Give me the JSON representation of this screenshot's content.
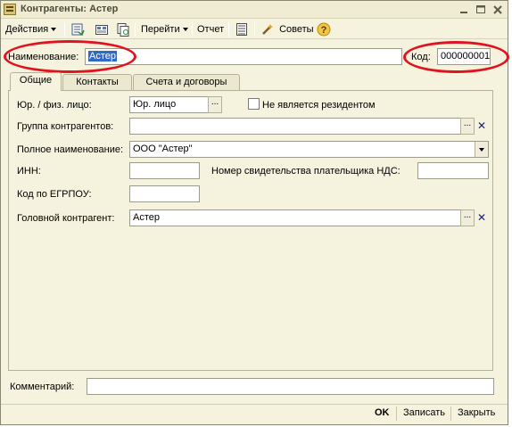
{
  "window": {
    "title": "Контрагенты: Астер"
  },
  "toolbar": {
    "actions_label": "Действия",
    "goto_label": "Перейти",
    "report_label": "Отчет",
    "tips_label": "Советы"
  },
  "header": {
    "name_label": "Наименование:",
    "name_value": "Астер",
    "code_label": "Код:",
    "code_value": "000000001"
  },
  "tabs": [
    {
      "label": "Общие",
      "active": true
    },
    {
      "label": "Контакты",
      "active": false
    },
    {
      "label": "Счета и договоры",
      "active": false
    }
  ],
  "form": {
    "legal_type_label": "Юр. / физ. лицо:",
    "legal_type_value": "Юр. лицо",
    "non_resident_label": "Не является резидентом",
    "group_label": "Группа контрагентов:",
    "group_value": "",
    "full_name_label": "Полное наименование:",
    "full_name_value": "ООО \"Астер\"",
    "inn_label": "ИНН:",
    "inn_value": "",
    "vat_cert_label": "Номер свидетельства плательщика НДС:",
    "vat_cert_value": "",
    "edrpou_label": "Код по ЕГРПОУ:",
    "edrpou_value": "",
    "parent_label": "Головной контрагент:",
    "parent_value": "Астер"
  },
  "comment": {
    "label": "Комментарий:",
    "value": ""
  },
  "footer": {
    "ok_label": "OK",
    "save_label": "Записать",
    "close_label": "Закрыть"
  },
  "colors": {
    "window_bg": "#f5f2dd",
    "selection": "#3169c6",
    "annotation_red": "#e0141e"
  }
}
